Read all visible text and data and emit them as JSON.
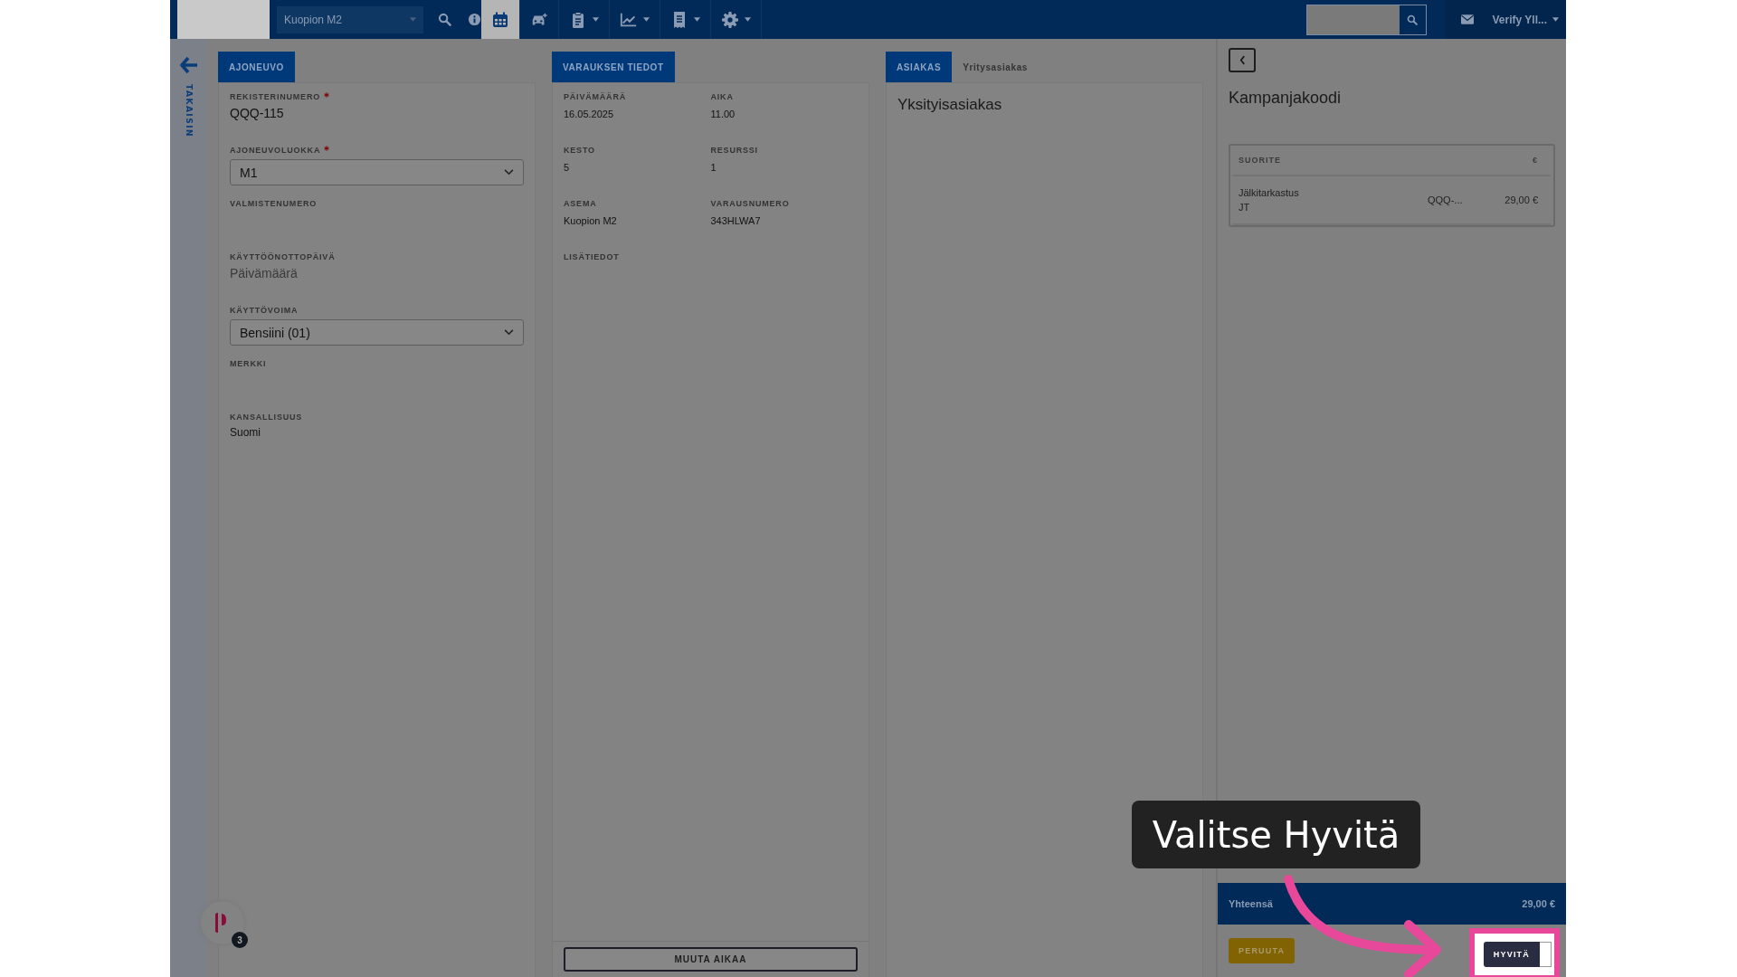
{
  "nav": {
    "station": "Kuopion M2",
    "tools": [
      {
        "kind": "calendar",
        "selected": true,
        "dropdown": false
      },
      {
        "kind": "car",
        "selected": false,
        "dropdown": false
      },
      {
        "kind": "clipboard",
        "selected": false,
        "dropdown": true
      },
      {
        "kind": "chart",
        "selected": false,
        "dropdown": true
      },
      {
        "kind": "receipt",
        "selected": false,
        "dropdown": true
      },
      {
        "kind": "gear",
        "selected": false,
        "dropdown": true
      }
    ],
    "user": "Verify Yll..."
  },
  "back_label": "TAKAISIN",
  "vehicle": {
    "tab": "AJONEUVO",
    "fields": [
      {
        "label": "REKISTERINUMERO",
        "required": true,
        "kind": "text",
        "value": "QQQ-115"
      },
      {
        "label": "AJONEUVOLUOKKA",
        "required": true,
        "kind": "select",
        "value": "M1"
      },
      {
        "label": "VALMISTENUMERO",
        "required": false,
        "kind": "empty"
      },
      {
        "label": "KÄYTTÖÖNOTTOPÄIVÄ",
        "required": false,
        "kind": "date",
        "placeholder": "Päivämäärä"
      },
      {
        "label": "KÄYTTÖVOIMA",
        "required": false,
        "kind": "select",
        "value": "Bensiini (01)"
      },
      {
        "label": "MERKKI",
        "required": false,
        "kind": "empty"
      },
      {
        "label": "KANSALLISUUS",
        "required": false,
        "kind": "small",
        "value": "Suomi"
      }
    ]
  },
  "reservation": {
    "tab": "VARAUKSEN TIEDOT",
    "fields": [
      {
        "label": "PÄIVÄMÄÄRÄ",
        "value": "16.05.2025"
      },
      {
        "label": "AIKA",
        "value": "11.00"
      },
      {
        "label": "KESTO",
        "value": "5"
      },
      {
        "label": "RESURSSI",
        "value": "1"
      },
      {
        "label": "ASEMA",
        "value": "Kuopion M2"
      },
      {
        "label": "VARAUSNUMERO",
        "value": "343HLWA7"
      },
      {
        "label": "LISÄTIEDOT"
      }
    ],
    "button": "MUUTA AIKAA"
  },
  "customer": {
    "tabs": [
      {
        "label": "ASIAKAS",
        "selected": true
      },
      {
        "label": "Yritysasiakas",
        "selected": false
      }
    ],
    "type": "Yksityisasiakas"
  },
  "cart": {
    "title": "Kampanjakoodi",
    "columns": {
      "service": "SUORITE",
      "price": "€"
    },
    "rows": [
      {
        "service": "Jälkitarkastus",
        "code": "JT",
        "column_2": "QQQ-...",
        "price": "29,00 €"
      }
    ],
    "total_label": "Yhteensä",
    "total": "29,00 €",
    "actions": [
      {
        "label": "PERUUTA",
        "kind": "cancel",
        "highlighted": false
      },
      {
        "label": "HYVITÄ",
        "kind": "refund",
        "highlighted": true
      }
    ]
  },
  "widget": {
    "badge": "3"
  },
  "callout": "Valitse Hyvitä"
}
